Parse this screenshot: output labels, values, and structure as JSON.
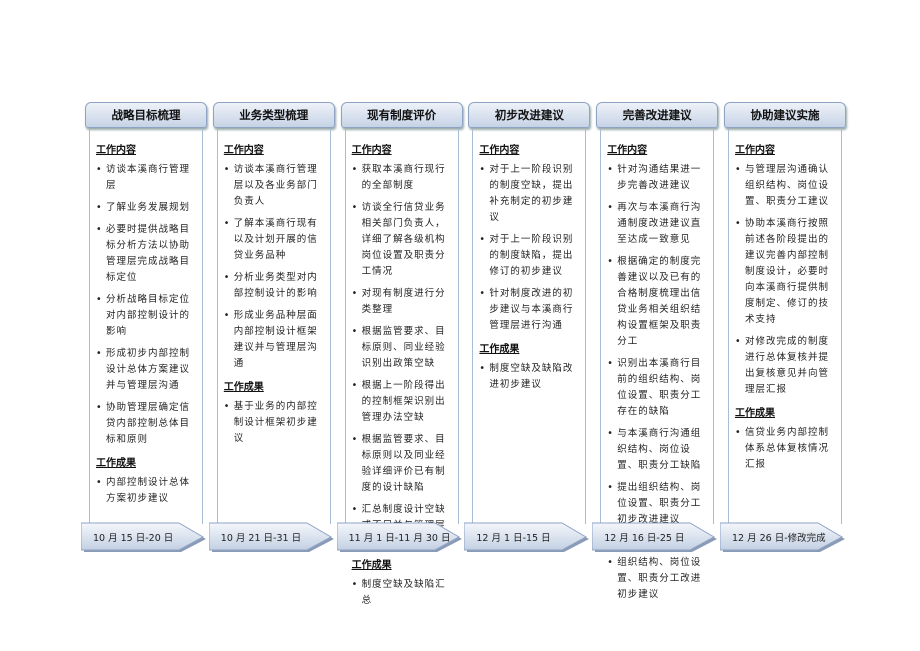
{
  "content_label": "工作内容",
  "result_label": "工作成果",
  "phases": [
    {
      "title": "战略目标梳理",
      "date": "10 月 15 日-20 日",
      "content": [
        "访谈本溪商行管理层",
        "了解业务发展规划",
        "必要时提供战略目标分析方法以协助管理层完成战略目标定位",
        "分析战略目标定位对内部控制设计的影响",
        "形成初步内部控制设计总体方案建议并与管理层沟通",
        "协助管理层确定信贷内部控制总体目标和原则"
      ],
      "results": [
        "内部控制设计总体方案初步建议"
      ]
    },
    {
      "title": "业务类型梳理",
      "date": "10 月 21 日-31 日",
      "content": [
        "访谈本溪商行管理层以及各业务部门负责人",
        "了解本溪商行现有以及计划开展的信贷业务品种",
        "分析业务类型对内部控制设计的影响",
        "形成业务品种层面内部控制设计框架建议并与管理层沟通"
      ],
      "results": [
        "基于业务的内部控制设计框架初步建议"
      ]
    },
    {
      "title": "现有制度评价",
      "date": "11 月 1 日-11 月 30 日",
      "content": [
        "获取本溪商行现行的全部制度",
        "访谈全行信贷业务相关部门负责人，详细了解各级机构岗位设置及职责分工情况",
        "对现有制度进行分类整理",
        "根据监管要求、目标原则、同业经验识别出政策空缺",
        "根据上一阶段得出的控制框架识别出管理办法空缺",
        "根据监管要求、目标原则以及同业经验详细评价已有制度的设计缺陷",
        "汇总制度设计空缺或不足并与管理层沟通确认"
      ],
      "results": [
        "制度空缺及缺陷汇总"
      ]
    },
    {
      "title": "初步改进建议",
      "date": "12 月 1 日-15 日",
      "content": [
        "对于上一阶段识别的制度空缺，提出补充制定的初步建议",
        "对于上一阶段识别的制度缺陷，提出修订的初步建议",
        "针对制度改进的初步建议与本溪商行管理层进行沟通"
      ],
      "results": [
        "制度空缺及缺陷改进初步建议"
      ]
    },
    {
      "title": "完善改进建议",
      "date": "12 月 16 日-25 日",
      "content": [
        "针对沟通结果进一步完善改进建议",
        "再次与本溪商行沟通制度改进建议直至达成一致意见",
        "根据确定的制度完善建议以及已有的合格制度梳理出信贷业务相关组织结构设置框架及职责分工",
        "识别出本溪商行目前的组织结构、岗位设置、职责分工存在的缺陷",
        "与本溪商行沟通组织结构、岗位设置、职责分工缺陷",
        "提出组织结构、岗位设置、职责分工初步改进建议"
      ],
      "results": [
        "组织结构、岗位设置、职责分工改进初步建议"
      ]
    },
    {
      "title": "协助建议实施",
      "date": "12 月 26 日-修改完成",
      "content": [
        "与管理层沟通确认组织结构、岗位设置、职责分工建议",
        "协助本溪商行按照前述各阶段提出的建议完善内部控制制度设计，必要时向本溪商行提供制度制定、修订的技术支持",
        "对修改完成的制度进行总体复核并提出复核意见并向管理层汇报"
      ],
      "results": [
        "信贷业务内部控制体系总体复核情况汇报"
      ]
    }
  ]
}
